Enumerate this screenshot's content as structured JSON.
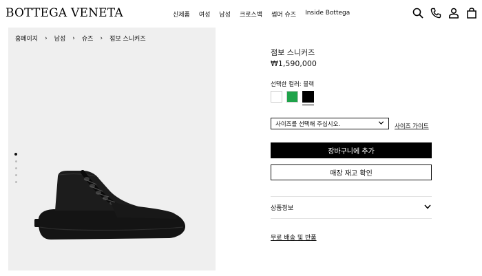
{
  "header": {
    "logo": "BOTTEGA VENETA",
    "nav": [
      "신제품",
      "여성",
      "남성",
      "크로스백",
      "썸머 슈즈",
      "Inside Bottega"
    ],
    "icons": [
      "search-icon",
      "phone-icon",
      "account-icon",
      "bag-icon"
    ]
  },
  "breadcrumb": [
    "홈페이지",
    "남성",
    "슈즈",
    "점보 스니커즈"
  ],
  "product": {
    "title": "점보 스니커즈",
    "price": "₩1,590,000",
    "color_label": "선택한 컬러: 블랙",
    "colors": [
      "#ffffff",
      "#1fa34a",
      "#000000"
    ],
    "selected_color_index": 2,
    "size_placeholder": "사이즈를 선택해 주십시오.",
    "size_guide": "사이즈 가이드",
    "add_to_cart": "장바구니에 추가",
    "check_stock": "매장 재고 확인",
    "product_info": "상품정보",
    "shipping_returns": "무료 배송 및 반품"
  },
  "gallery": {
    "image_count": 5,
    "active_index": 0
  }
}
